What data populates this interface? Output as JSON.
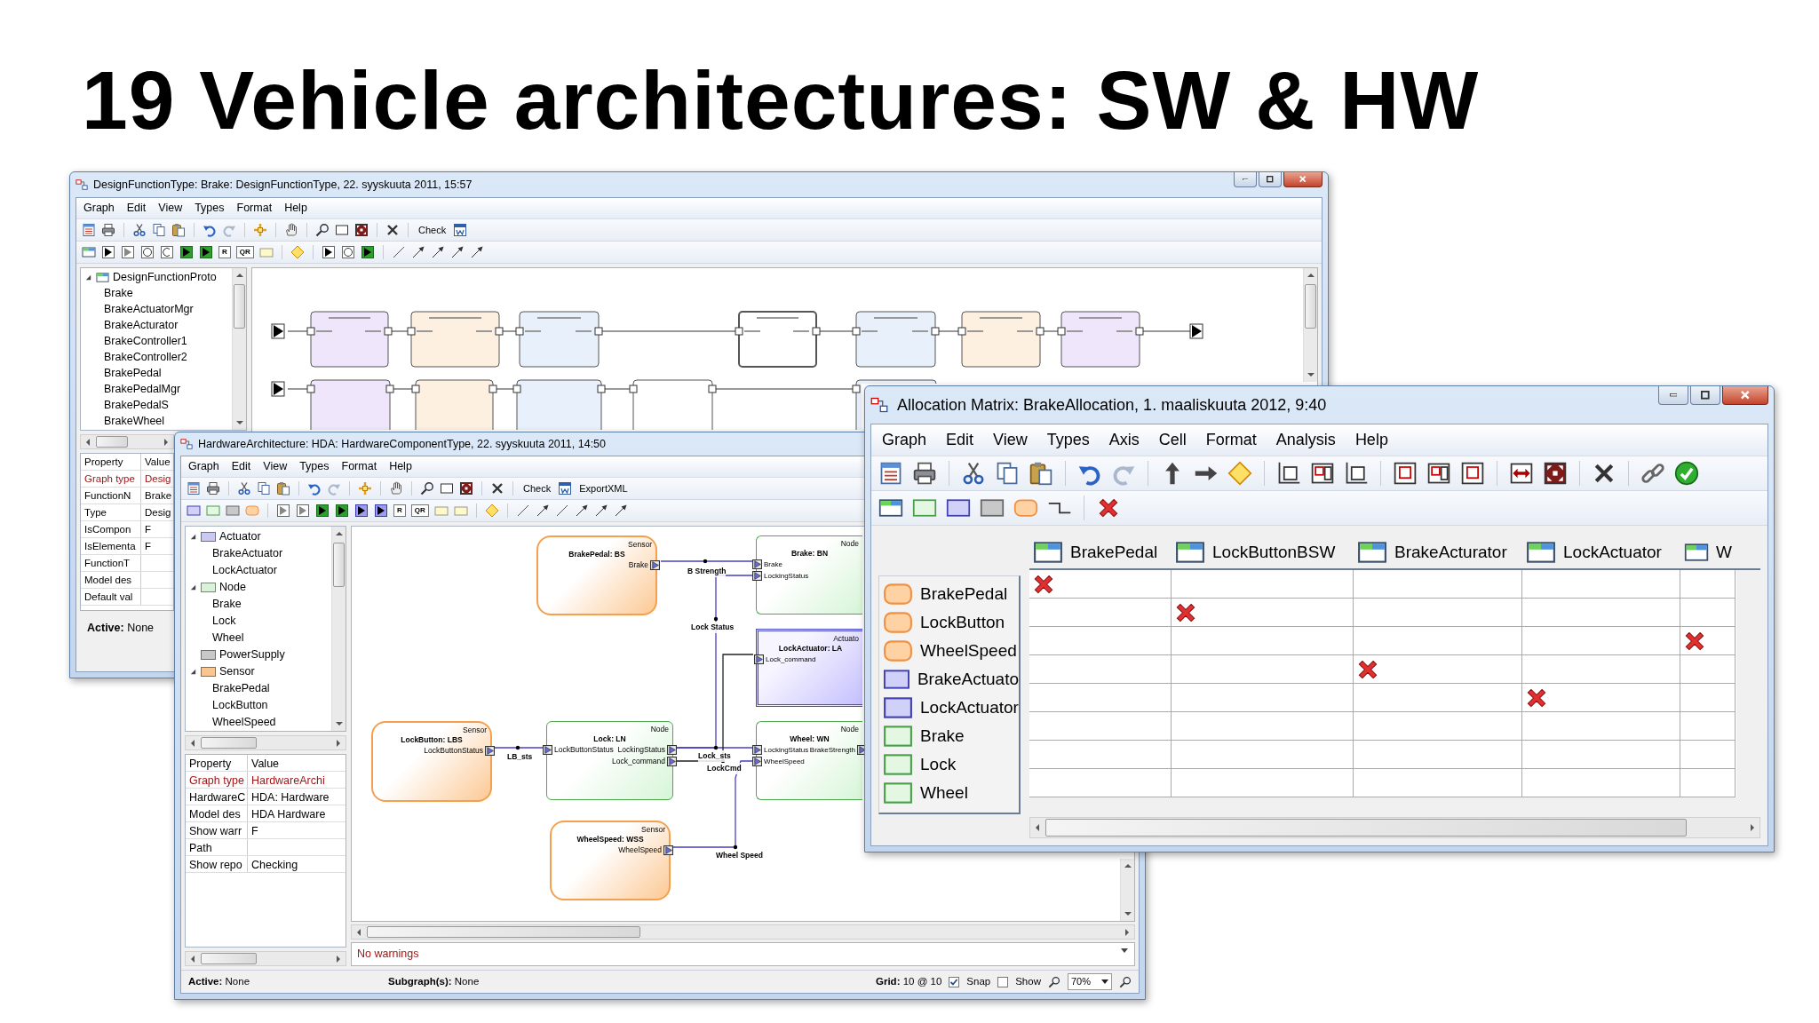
{
  "slide_title": "19 Vehicle architectures: SW & HW",
  "design_window": {
    "title": "DesignFunctionType: Brake: DesignFunctionType, 22. syyskuuta 2011, 15:57",
    "menu": [
      "Graph",
      "Edit",
      "View",
      "Types",
      "Format",
      "Help"
    ],
    "toolbar_texts": [
      "Check",
      "R",
      "QR"
    ],
    "tree": {
      "label": "DesignFunctionProto",
      "expanded": true,
      "children": [
        {
          "label": "Brake"
        },
        {
          "label": "BrakeActuatorMgr"
        },
        {
          "label": "BrakeActurator"
        },
        {
          "label": "BrakeController1"
        },
        {
          "label": "BrakeController2"
        },
        {
          "label": "BrakePedal"
        },
        {
          "label": "BrakePedalMgr"
        },
        {
          "label": "BrakePedalS"
        },
        {
          "label": "BrakeWheel"
        }
      ]
    },
    "properties": {
      "columns": [
        "Property",
        "Value"
      ],
      "rows": [
        {
          "name": "Graph type",
          "value": "Desig",
          "highlighted": true
        },
        {
          "name": "FunctionN",
          "value": "Brake",
          "highlighted": false
        },
        {
          "name": "Type",
          "value": "Desig",
          "highlighted": false
        },
        {
          "name": "IsCompon",
          "value": "F",
          "highlighted": false
        },
        {
          "name": "IsElementa",
          "value": "F",
          "highlighted": false
        },
        {
          "name": "FunctionT",
          "highlighted": false
        },
        {
          "name": "Model des",
          "highlighted": false
        },
        {
          "name": "Default val",
          "highlighted": false
        }
      ]
    },
    "status": "**Active:** None"
  },
  "hardware_window": {
    "title": "HardwareArchitecture: HDA: HardwareComponentType, 22. syyskuuta 2011, 14:50",
    "menu": [
      "Graph",
      "Edit",
      "View",
      "Types",
      "Format",
      "Help"
    ],
    "toolbar_texts": [
      "Check",
      "ExportXML",
      "R",
      "QR"
    ],
    "tree": [
      {
        "label": "Actuator",
        "color": "#c9c9f2",
        "expanded": true,
        "children": [
          {
            "label": "BrakeActuator"
          },
          {
            "label": "LockActuator"
          }
        ]
      },
      {
        "label": "Node",
        "color": "#d9f2d9",
        "expanded": true,
        "children": [
          {
            "label": "Brake"
          },
          {
            "label": "Lock"
          },
          {
            "label": "Wheel"
          }
        ]
      },
      {
        "label": "PowerSupply",
        "color": "#c8c8c8"
      },
      {
        "label": "Sensor",
        "color": "#fbc58f",
        "expanded": true,
        "children": [
          {
            "label": "BrakePedal"
          },
          {
            "label": "LockButton"
          },
          {
            "label": "WheelSpeed"
          }
        ]
      }
    ],
    "properties": {
      "columns": [
        "Property",
        "Value"
      ],
      "rows": [
        {
          "name": "Graph type",
          "value": "HardwareArchi",
          "highlighted": true
        },
        {
          "name": "HardwareC",
          "value": "HDA: Hardware",
          "highlighted": false
        },
        {
          "name": "Model des",
          "value": "HDA Hardware",
          "highlighted": false
        },
        {
          "name": "Show warr",
          "value": "F",
          "highlighted": false
        },
        {
          "name": "Path",
          "highlighted": false
        },
        {
          "name": "Show repo",
          "value": "Checking",
          "highlighted": false
        }
      ]
    },
    "diagram": {
      "nodes": [
        {
          "kind": "sensor",
          "type_label": "Sensor",
          "name": "BrakePedal: BS",
          "ports": [
            {
              "out": "Brake"
            }
          ]
        },
        {
          "kind": "node",
          "type_label": "Node",
          "name": "Brake: BN",
          "ports": [
            {
              "in": "Brake"
            },
            {
              "in": "LockingStatus"
            }
          ]
        },
        {
          "kind": "actuator",
          "type_label": "Actuato",
          "name": "LockActuator: LA",
          "ports": [
            {
              "in": "Lock_command"
            }
          ]
        },
        {
          "kind": "sensor",
          "type_label": "Sensor",
          "name": "LockButton: LBS",
          "ports": [
            {
              "out": "LockButtonStatus"
            }
          ]
        },
        {
          "kind": "node",
          "type_label": "Node",
          "name": "Lock: LN",
          "ports": [
            {
              "in": "LockButtonStatus",
              "out": "LockingStatus"
            },
            {
              "out": "Lock_command"
            }
          ]
        },
        {
          "kind": "node",
          "type_label": "Node",
          "name": "Wheel: WN",
          "ports": [
            {
              "in": "LockingStatus",
              "out": "BrakeStrength"
            },
            {
              "in": "WheelSpeed"
            }
          ]
        },
        {
          "kind": "sensor",
          "type_label": "Sensor",
          "name": "WheelSpeed: WSS",
          "ports": [
            {
              "out": "WheelSpeed"
            }
          ]
        }
      ],
      "wires": [
        {
          "label": "B Strength"
        },
        {
          "label": "Lock Status"
        },
        {
          "label": "Lock_sts"
        },
        {
          "label": "LockCmd"
        },
        {
          "label": "LB_sts"
        },
        {
          "label": "Wheel Speed"
        }
      ]
    },
    "message": "No warnings",
    "status": {
      "active": "**Active:** None",
      "subgraphs": "**Subgraph(s):** None",
      "grid": "**Grid:** 10 @ 10",
      "snap": {
        "label": "Snap",
        "checked": true
      },
      "show": {
        "label": "Show",
        "checked": false
      },
      "zoom": "70%"
    }
  },
  "matrix_window": {
    "title": "Allocation Matrix: BrakeAllocation, 1. maaliskuuta 2012, 9:40",
    "menu": [
      "Graph",
      "Edit",
      "View",
      "Types",
      "Axis",
      "Cell",
      "Format",
      "Analysis",
      "Help"
    ],
    "columns": [
      {
        "label": "BrakePedal"
      },
      {
        "label": "LockButtonBSW"
      },
      {
        "label": "BrakeActurator"
      },
      {
        "label": "LockActuator"
      },
      {
        "label": "W"
      }
    ],
    "rows": [
      {
        "kind": "sensor",
        "label": "BrakePedal",
        "cells": [
          true,
          false,
          false,
          false,
          false
        ]
      },
      {
        "kind": "sensor",
        "label": "LockButton",
        "cells": [
          false,
          true,
          false,
          false,
          false
        ]
      },
      {
        "kind": "sensor",
        "label": "WheelSpeed",
        "cells": [
          false,
          false,
          false,
          false,
          true
        ]
      },
      {
        "kind": "actuator",
        "label": "BrakeActuato",
        "cells": [
          false,
          false,
          true,
          false,
          false
        ]
      },
      {
        "kind": "actuator",
        "label": "LockActuator",
        "cells": [
          false,
          false,
          false,
          true,
          false
        ]
      },
      {
        "kind": "node",
        "label": "Brake",
        "cells": [
          false,
          false,
          false,
          false,
          false
        ]
      },
      {
        "kind": "node",
        "label": "Lock",
        "cells": [
          false,
          false,
          false,
          false,
          false
        ]
      },
      {
        "kind": "node",
        "label": "Wheel",
        "cells": [
          false,
          false,
          false,
          false,
          false
        ]
      }
    ]
  }
}
